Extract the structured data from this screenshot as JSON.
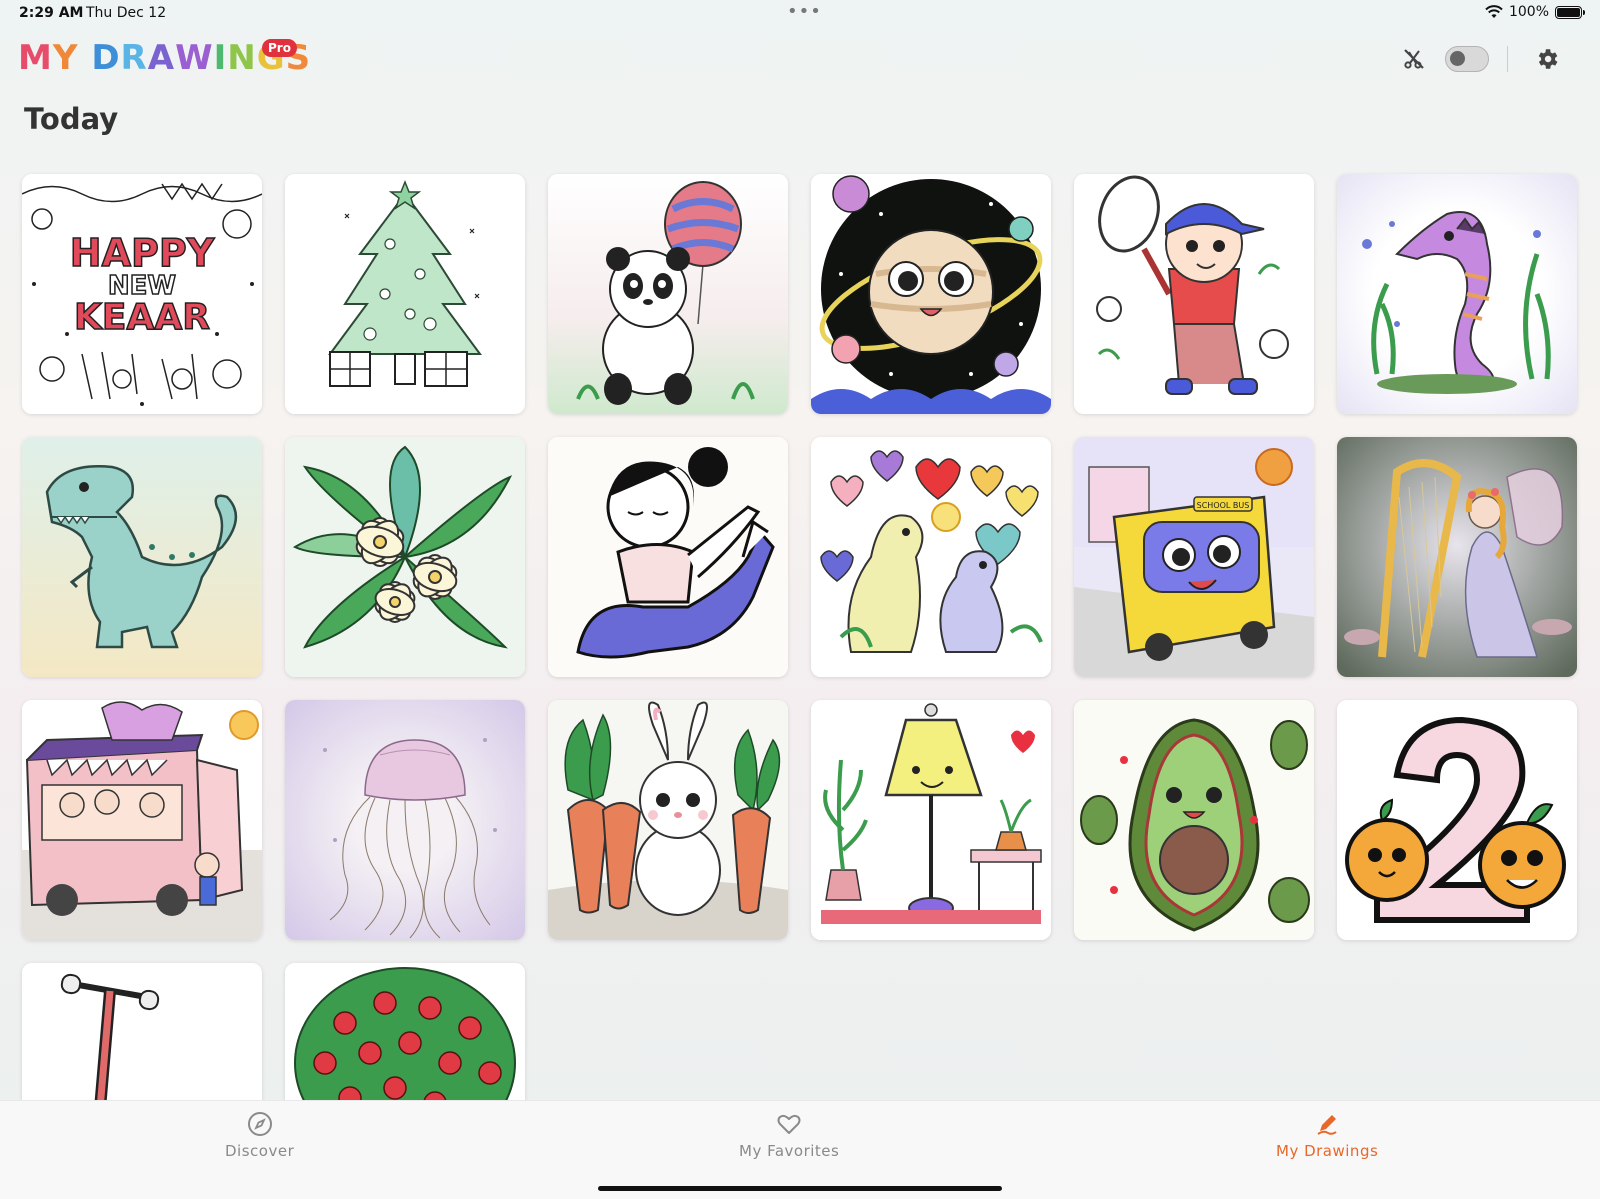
{
  "status_bar": {
    "time": "2:29 AM",
    "date": "Thu Dec 12",
    "battery": "100%"
  },
  "header": {
    "title_letters": [
      "M",
      "Y",
      " ",
      "D",
      "R",
      "A",
      "W",
      "I",
      "N",
      "G",
      "S"
    ],
    "title_colors": [
      "#e74c6a",
      "#f0883a",
      "#ffffff",
      "#3f8fd8",
      "#5bb4e6",
      "#7a63d1",
      "#9a5fd0",
      "#4fba6f",
      "#8fc64a",
      "#e8c23a",
      "#f08a3a"
    ],
    "badge": "Pro",
    "icons": [
      "scissors-off-icon",
      "toggle-switch",
      "gear-icon"
    ]
  },
  "section": {
    "title": "Today"
  },
  "drawings": [
    {
      "subject": "Happy New Year doodle",
      "text": [
        "HAPPY",
        "NEW",
        "KEAAR"
      ]
    },
    {
      "subject": "Christmas tree with gifts"
    },
    {
      "subject": "Panda with balloon"
    },
    {
      "subject": "Smiling planet in space"
    },
    {
      "subject": "Boy with tennis racket"
    },
    {
      "subject": "Seahorse with seaweed"
    },
    {
      "subject": "T-rex dinosaur"
    },
    {
      "subject": "Plumeria flowers with leaves"
    },
    {
      "subject": "Girl doing yoga"
    },
    {
      "subject": "Dinosaurs with heart balloons"
    },
    {
      "subject": "Cartoon school bus",
      "text": [
        "SCHOOL BUS"
      ]
    },
    {
      "subject": "Fairy playing harp"
    },
    {
      "subject": "Ice cream truck"
    },
    {
      "subject": "Jellyfish"
    },
    {
      "subject": "Bunny with carrots"
    },
    {
      "subject": "Smiling lamp with plants"
    },
    {
      "subject": "Happy avocado"
    },
    {
      "subject": "Number 2 with oranges"
    },
    {
      "subject": "Scooter"
    },
    {
      "subject": "Apple tree"
    }
  ],
  "tabbar": {
    "tabs": [
      {
        "label": "Discover",
        "icon": "compass-icon",
        "active": false
      },
      {
        "label": "My Favorites",
        "icon": "heart-icon",
        "active": false
      },
      {
        "label": "My Drawings",
        "icon": "pencil-edit-icon",
        "active": true
      }
    ],
    "active_color": "#e8682a",
    "inactive_color": "#8a8a8a"
  }
}
